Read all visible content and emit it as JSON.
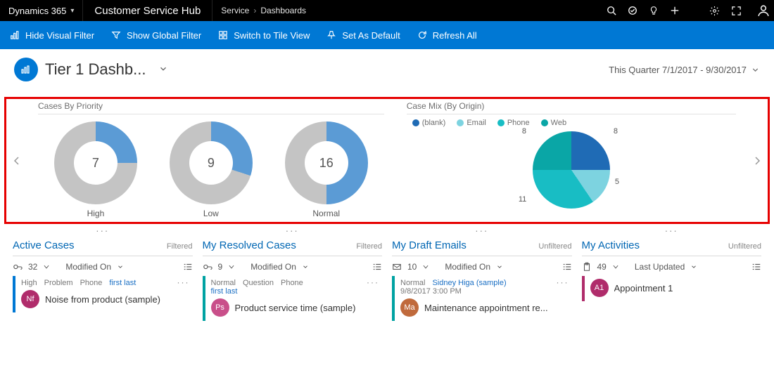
{
  "topbar": {
    "brand": "Dynamics 365",
    "hub": "Customer Service Hub",
    "crumb1": "Service",
    "crumb2": "Dashboards"
  },
  "cmd": {
    "hide": "Hide Visual Filter",
    "global": "Show Global Filter",
    "tile": "Switch to Tile View",
    "default": "Set As Default",
    "refresh": "Refresh All"
  },
  "page": {
    "title": "Tier 1 Dashb...",
    "range": "This Quarter 7/1/2017 - 9/30/2017"
  },
  "chart_data": [
    {
      "type": "pie",
      "title": "Cases By Priority",
      "series": [
        {
          "name": "High",
          "value": 7,
          "slices": [
            {
              "label": "blue",
              "value": 25,
              "color": "#5b9bd5"
            },
            {
              "label": "grey",
              "value": 75,
              "color": "#c4c4c4"
            }
          ]
        },
        {
          "name": "Low",
          "value": 9,
          "slices": [
            {
              "label": "blue",
              "value": 30,
              "color": "#5b9bd5"
            },
            {
              "label": "grey",
              "value": 70,
              "color": "#c4c4c4"
            }
          ]
        },
        {
          "name": "Normal",
          "value": 16,
          "slices": [
            {
              "label": "blue",
              "value": 50,
              "color": "#5b9bd5"
            },
            {
              "label": "grey",
              "value": 50,
              "color": "#c4c4c4"
            }
          ]
        }
      ]
    },
    {
      "type": "pie",
      "title": "Case Mix (By Origin)",
      "legend": [
        "(blank)",
        "Email",
        "Phone",
        "Web"
      ],
      "colors": {
        "(blank)": "#1f6bb5",
        "Email": "#7dd3e0",
        "Phone": "#18bdc4",
        "Web": "#0aa6a6"
      },
      "data": [
        {
          "name": "(blank)",
          "value": 8
        },
        {
          "name": "Email",
          "value": 5
        },
        {
          "name": "Phone",
          "value": 11
        },
        {
          "name": "Web",
          "value": 8
        }
      ]
    }
  ],
  "streams": {
    "active": {
      "title": "Active Cases",
      "filter": "Filtered",
      "count": "32",
      "sort": "Modified On",
      "tag1": "High",
      "tag2": "Problem",
      "tag3": "Phone",
      "tag4": "first last",
      "item": "Noise from product (sample)",
      "badge": "Nf",
      "badgeColor": "#b02c6b"
    },
    "resolved": {
      "title": "My Resolved Cases",
      "filter": "Filtered",
      "count": "9",
      "sort": "Modified On",
      "tag1": "Normal",
      "tag2": "Question",
      "tag3": "Phone",
      "tag4": "first last",
      "item": "Product service time (sample)",
      "badge": "Ps",
      "badgeColor": "#c94f8a"
    },
    "drafts": {
      "title": "My Draft Emails",
      "filter": "Unfiltered",
      "count": "10",
      "sort": "Modified On",
      "tag1": "Normal",
      "tag2": "Sidney Higa (sample)",
      "tag3": "9/8/2017 3:00 PM",
      "item": "Maintenance appointment re...",
      "badge": "Ma",
      "badgeColor": "#c06a3c"
    },
    "activities": {
      "title": "My Activities",
      "filter": "Unfiltered",
      "count": "49",
      "sort": "Last Updated",
      "item": "Appointment 1",
      "badge": "A1",
      "badgeColor": "#b02c6b"
    }
  }
}
